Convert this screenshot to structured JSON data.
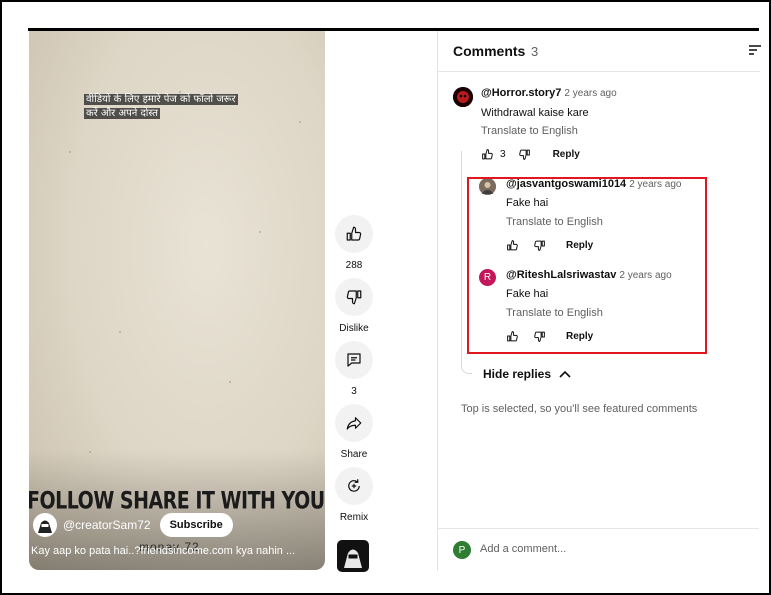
{
  "video": {
    "overlay_line1": "वीडियो के लिए हमारे पेज को फॉलो जरूर",
    "overlay_line2": "करें और अपने दोस्त",
    "big_caption": "FOLLOW SHARE IT WITH YOUR FRIENDS.",
    "channel_name": "@creatorSam72",
    "subscribe_label": "Subscribe",
    "description": "Kay aap ko pata hai..?friendsincome.com kya nahin ...",
    "description_ghost": "money 72"
  },
  "actions": {
    "like_count": "288",
    "dislike_label": "Dislike",
    "comment_count": "3",
    "share_label": "Share",
    "remix_label": "Remix"
  },
  "comments_panel": {
    "title": "Comments",
    "count": "3",
    "comments": [
      {
        "author": "@Horror.story7",
        "age": "2 years ago",
        "text": "Withdrawal kaise kare",
        "translate": "Translate to English",
        "likes": "3",
        "reply_label": "Reply"
      }
    ],
    "replies": [
      {
        "author": "@jasvantgoswami1014",
        "age": "2 years ago",
        "text": "Fake hai",
        "translate": "Translate to English",
        "reply_label": "Reply"
      },
      {
        "author": "@RiteshLalsriwastav",
        "age": "2 years ago",
        "text": "Fake hai",
        "translate": "Translate to English",
        "reply_label": "Reply",
        "avatar_letter": "R",
        "avatar_color": "#c2185b"
      }
    ],
    "hide_replies_label": "Hide replies",
    "featured_note": "Top is selected, so you'll see featured comments",
    "add_comment_placeholder": "Add a comment...",
    "user_avatar_letter": "P",
    "user_avatar_color": "#2e7d32"
  },
  "colors": {
    "highlight_box": "#e0171e"
  }
}
